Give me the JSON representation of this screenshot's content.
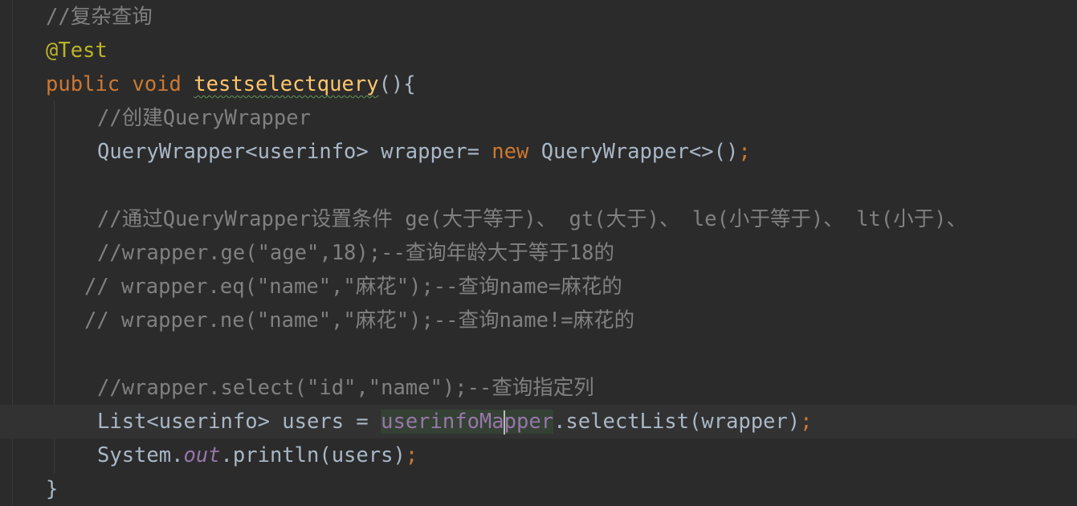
{
  "lines": {
    "l1": {
      "comment": "//复杂查询"
    },
    "l2": {
      "annotation": "@Test"
    },
    "l3": {
      "kw_public": "public",
      "kw_void": "void",
      "method_name": "testselectquery",
      "rest": "(){"
    },
    "l4": {
      "comment": "//创建QueryWrapper"
    },
    "l5": {
      "type": "QueryWrapper<userinfo> wrapper= ",
      "kw_new": "new",
      "rest": " QueryWrapper<>()",
      "semicolon": ";"
    },
    "l6": {
      "comment": "//通过QueryWrapper设置条件 ge(大于等于)、 gt(大于)、 le(小于等于)、 lt(小于)、"
    },
    "l7": {
      "comment": "//wrapper.ge(\"age\",18);--查询年龄大于等于18的"
    },
    "l8": {
      "comment": "// wrapper.eq(\"name\",\"麻花\");--查询name=麻花的"
    },
    "l9": {
      "comment": "// wrapper.ne(\"name\",\"麻花\");--查询name!=麻花的"
    },
    "l10": {
      "comment": "//wrapper.select(\"id\",\"name\");--查询指定列"
    },
    "l11": {
      "type": "List<userinfo> users = ",
      "field_a": "userinfoMa",
      "field_b": "pper",
      "rest": ".selectList(wrapper)",
      "semicolon": ";"
    },
    "l12": {
      "prefix": "System.",
      "static_field": "out",
      "rest": ".println(users)",
      "semicolon": ";"
    },
    "l13": {
      "brace": "}"
    }
  }
}
